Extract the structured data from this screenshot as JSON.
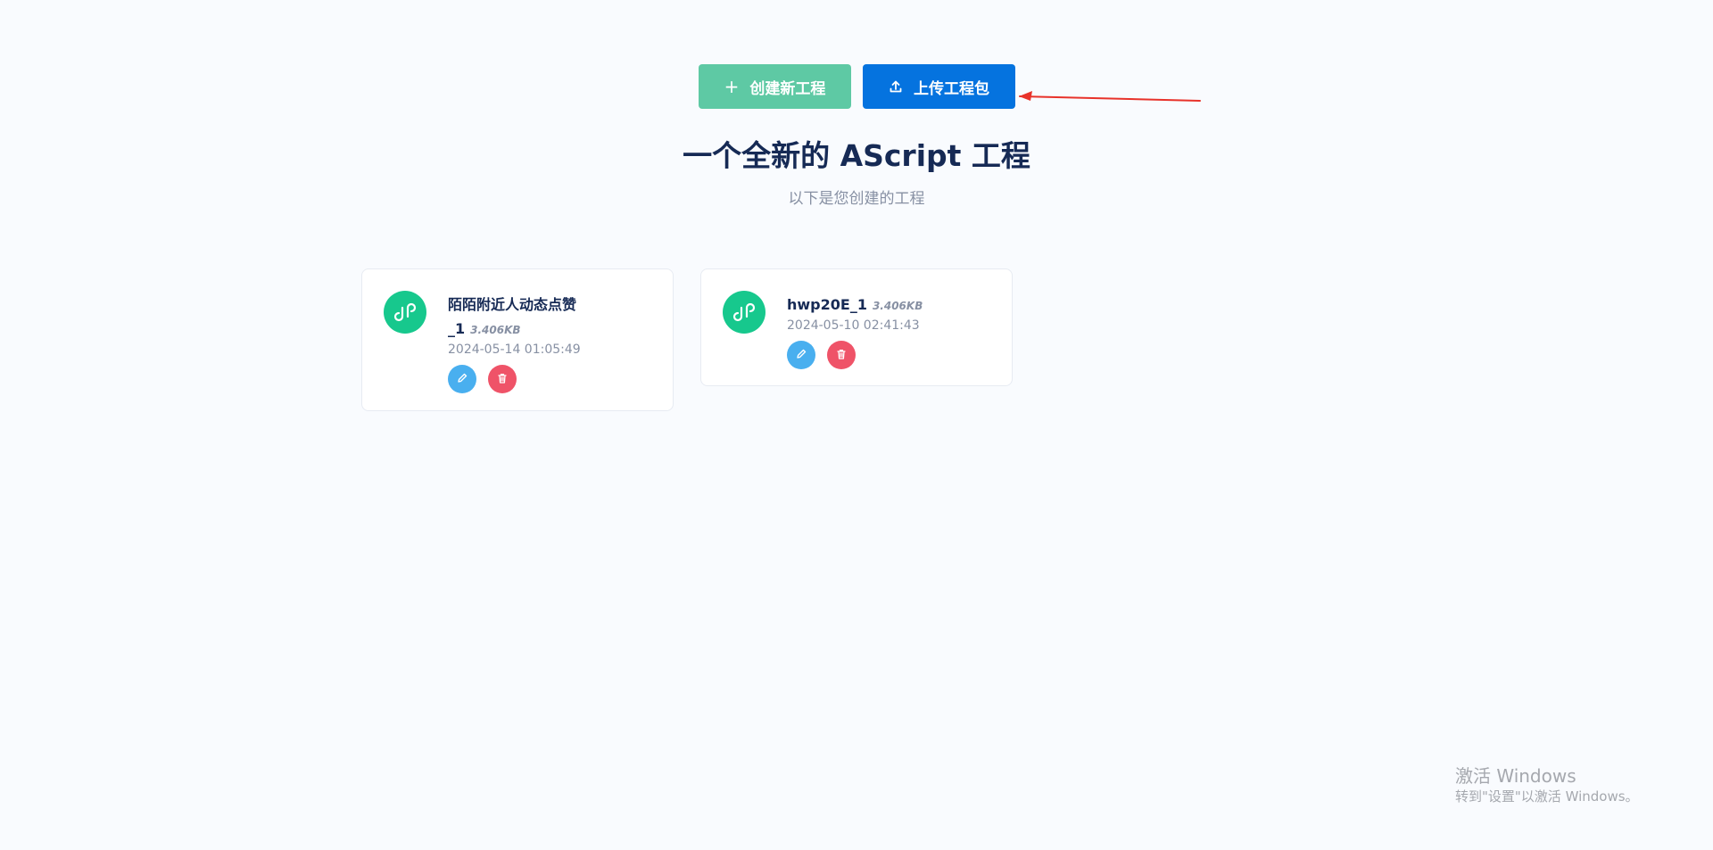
{
  "toolbar": {
    "create_label": "创建新工程",
    "upload_label": "上传工程包"
  },
  "hero": {
    "title": "一个全新的 AScript 工程",
    "subtitle": "以下是您创建的工程"
  },
  "projects": [
    {
      "name": "陌陌附近人动态点赞_1",
      "size": "3.406KB",
      "date": "2024-05-14 01:05:49"
    },
    {
      "name": "hwp20E_1",
      "size": "3.406KB",
      "date": "2024-05-10 02:41:43"
    }
  ],
  "watermark": {
    "title": "激活 Windows",
    "subtitle": "转到\"设置\"以激活 Windows。"
  },
  "colors": {
    "create_button": "#5ec9a4",
    "upload_button": "#0573df",
    "project_icon": "#17c88d",
    "edit_button": "#49afef",
    "delete_button": "#ef5368",
    "annotation_arrow": "#e8322a"
  },
  "icons": {
    "create": "plus-icon",
    "upload": "upload-icon",
    "project": "mini-program-link-icon",
    "edit": "pencil-icon",
    "delete": "trash-icon",
    "annotation": "red-arrow-icon"
  }
}
